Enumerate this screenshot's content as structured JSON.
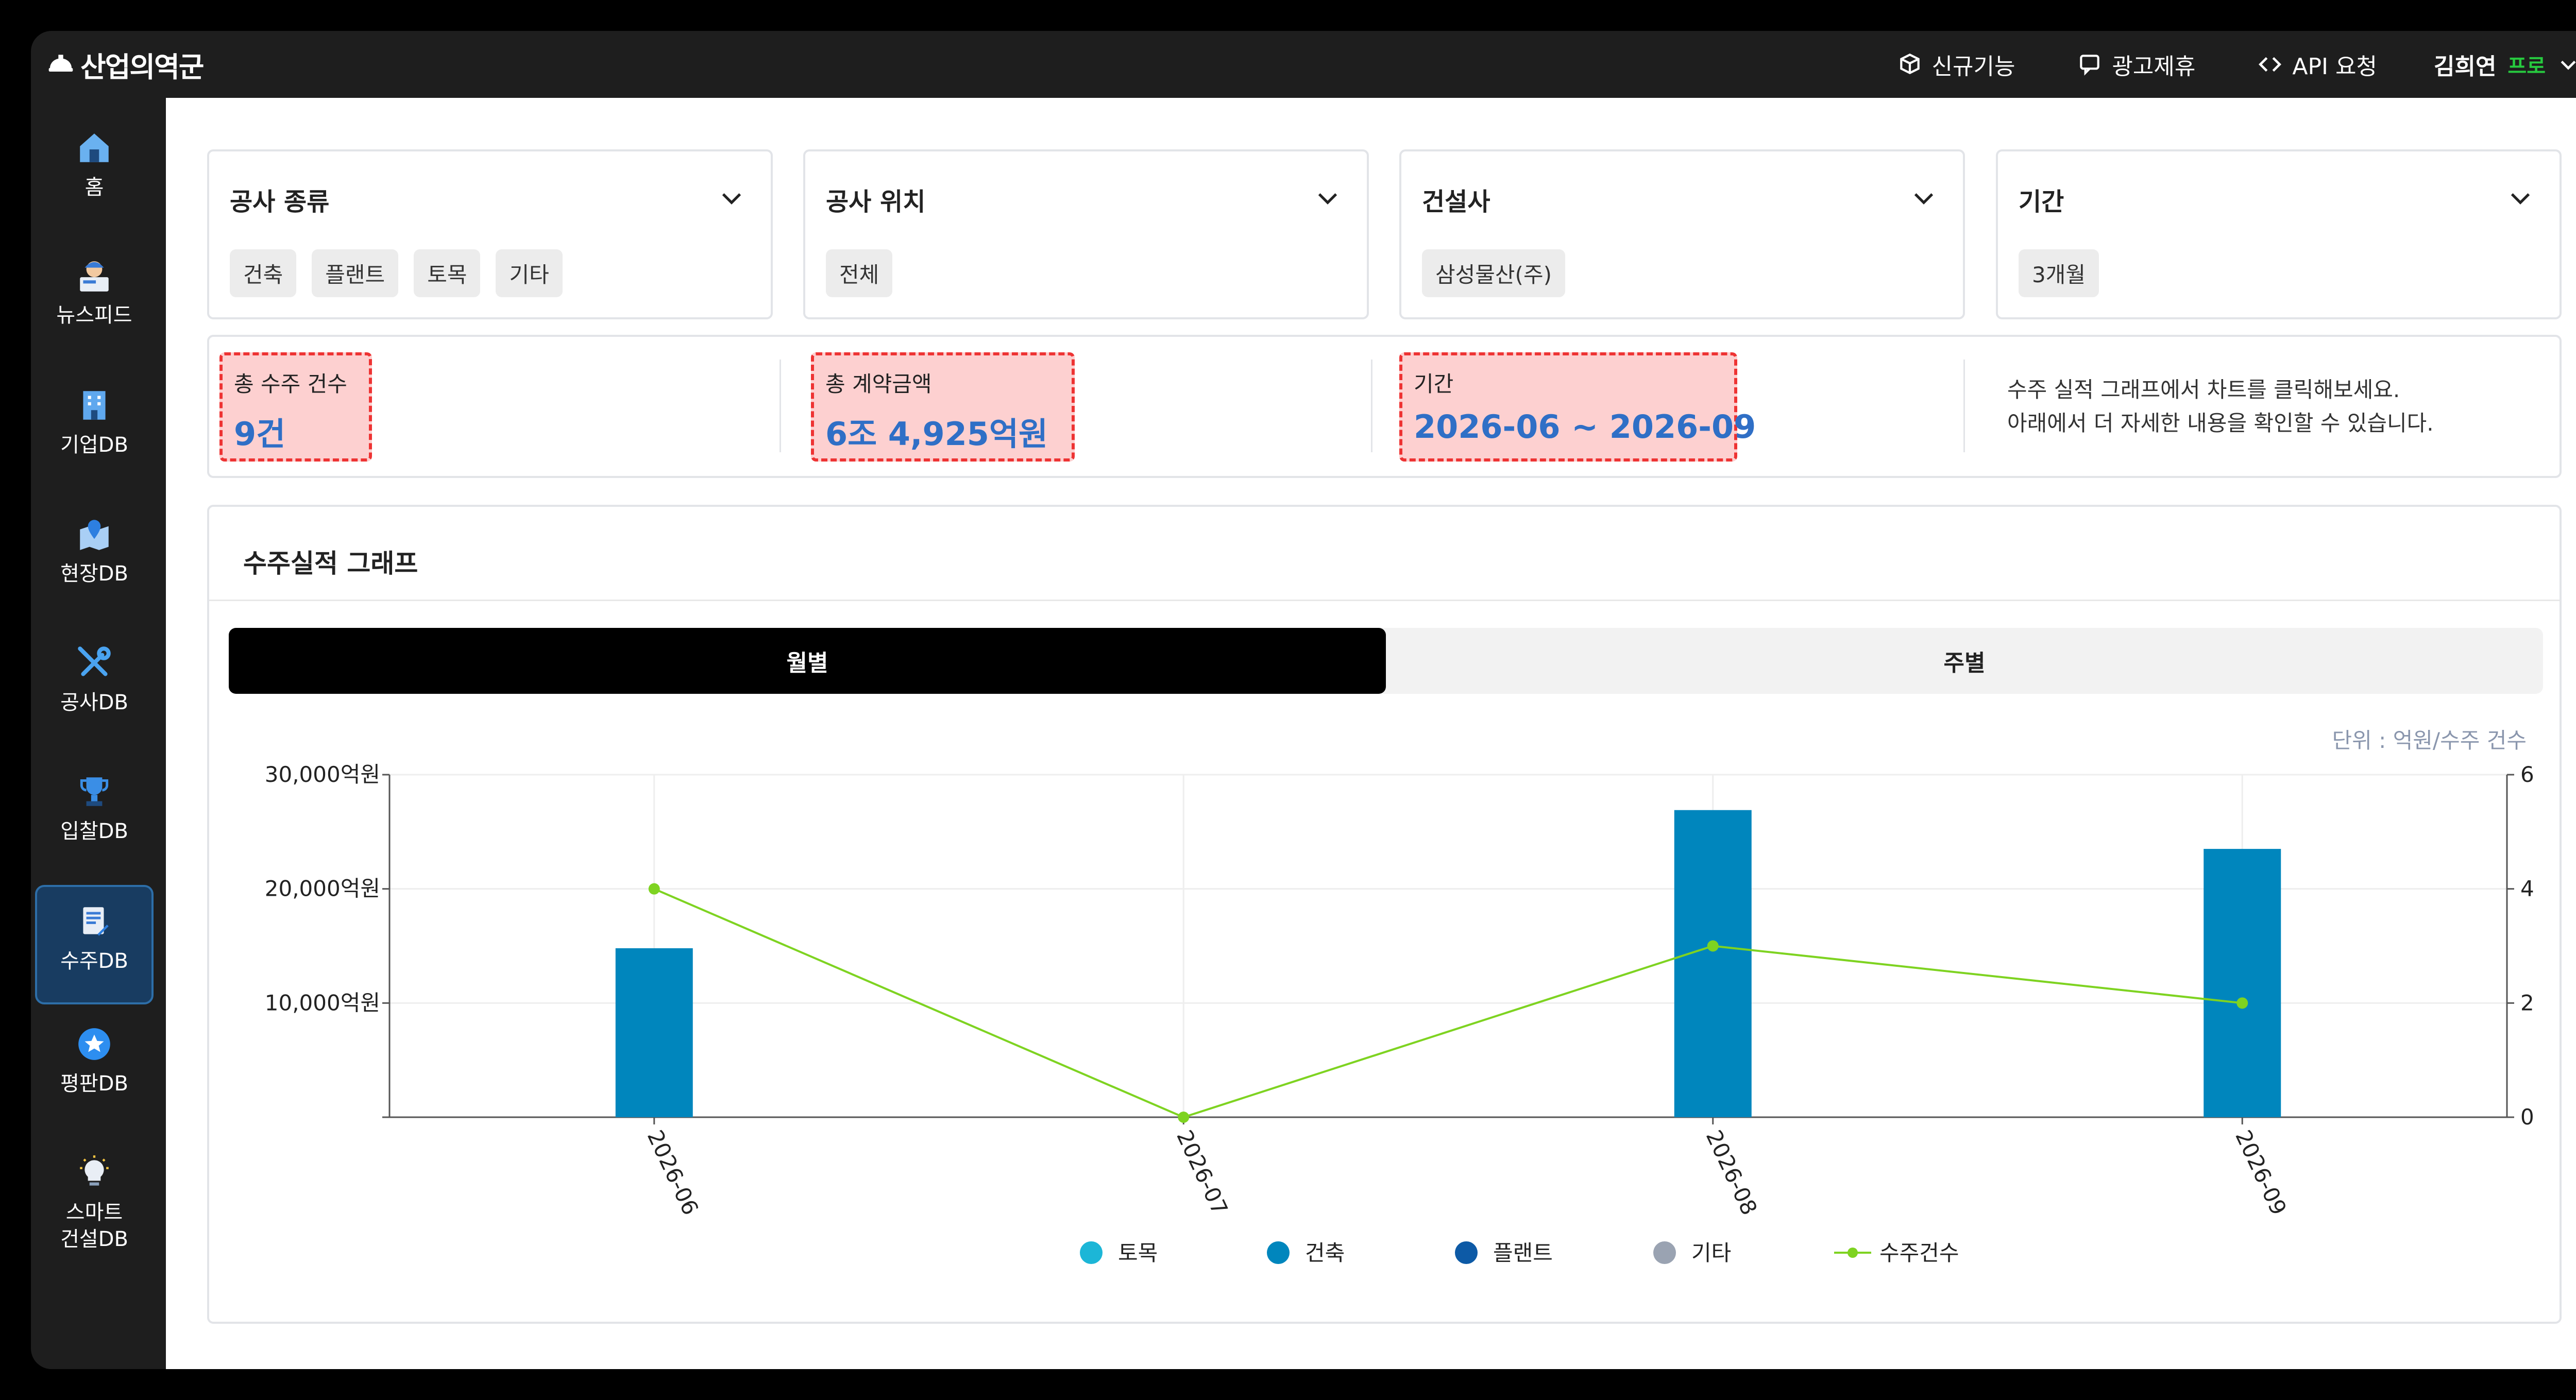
{
  "app": {
    "logo_text": "산업의역군",
    "nav": [
      {
        "label": "신규기능",
        "icon": "box-plus-icon"
      },
      {
        "label": "광고제휴",
        "icon": "chat-bubble-icon"
      },
      {
        "label": "API 요청",
        "icon": "code-icon"
      }
    ],
    "user": {
      "name": "김희연",
      "badge": "프로"
    }
  },
  "sidebar": {
    "items": [
      {
        "label": "홈",
        "icon": "home-icon"
      },
      {
        "label": "뉴스피드",
        "icon": "newspaper-icon"
      },
      {
        "label": "기업DB",
        "icon": "building-icon"
      },
      {
        "label": "현장DB",
        "icon": "map-pin-icon"
      },
      {
        "label": "공사DB",
        "icon": "tools-icon"
      },
      {
        "label": "입찰DB",
        "icon": "trophy-icon"
      },
      {
        "label": "수주DB",
        "icon": "contract-icon",
        "active": true
      },
      {
        "label": "평판DB",
        "icon": "star-icon"
      },
      {
        "label": "스마트 건설DB",
        "label_line1": "스마트",
        "label_line2": "건설DB",
        "icon": "lightbulb-icon"
      }
    ]
  },
  "filters": [
    {
      "title": "공사 종류",
      "chips": [
        "건축",
        "플랜트",
        "토목",
        "기타"
      ]
    },
    {
      "title": "공사 위치",
      "chips": [
        "전체"
      ]
    },
    {
      "title": "건설사",
      "chips": [
        "삼성물산(주)"
      ]
    },
    {
      "title": "기간",
      "chips": [
        "3개월"
      ]
    }
  ],
  "summary": {
    "total_count_label": "총 수주 건수",
    "total_count_value": "9건",
    "total_amount_label": "총 계약금액",
    "total_amount_value": "6조 4,925억원",
    "period_label": "기간",
    "period_value": "2026-06 ~ 2026-09",
    "hint_line1": "수주 실적 그래프에서 차트를 클릭해보세요.",
    "hint_line2": "아래에서 더 자세한 내용을 확인할 수 있습니다."
  },
  "graph": {
    "title": "수주실적 그래프",
    "tabs": {
      "monthly": "월별",
      "weekly": "주별"
    },
    "unit": "단위 : 억원/수주 건수"
  },
  "colors": {
    "bar": "#0086bd",
    "line": "#7ed321",
    "civil": "#1cb6d7",
    "building": "#0086bd",
    "plant": "#0d5aa6",
    "other": "#9aa3b2",
    "accent": "#2f6fc6"
  },
  "chart_data": {
    "type": "bar",
    "categories": [
      "2026-06",
      "2026-07",
      "2026-08",
      "2026-09"
    ],
    "series": [
      {
        "name": "토목",
        "values": [
          0,
          0,
          0,
          0
        ]
      },
      {
        "name": "건축",
        "values": [
          14800,
          0,
          26900,
          23500
        ]
      },
      {
        "name": "플랜트",
        "values": [
          0,
          0,
          0,
          0
        ]
      },
      {
        "name": "기타",
        "values": [
          0,
          0,
          0,
          0
        ]
      },
      {
        "name": "수주건수",
        "type": "line",
        "axis": "right",
        "values": [
          4,
          0,
          3,
          2
        ]
      }
    ],
    "ylim": [
      0,
      30000
    ],
    "yticks": [
      10000,
      20000,
      30000
    ],
    "ytick_labels": [
      "10,000억원",
      "20,000억원",
      "30,000억원"
    ],
    "y2lim": [
      0,
      6
    ],
    "y2ticks": [
      0,
      2,
      4,
      6
    ],
    "legend": [
      "토목",
      "건축",
      "플랜트",
      "기타",
      "수주건수"
    ],
    "legend_position": "bottom",
    "grid": true
  }
}
